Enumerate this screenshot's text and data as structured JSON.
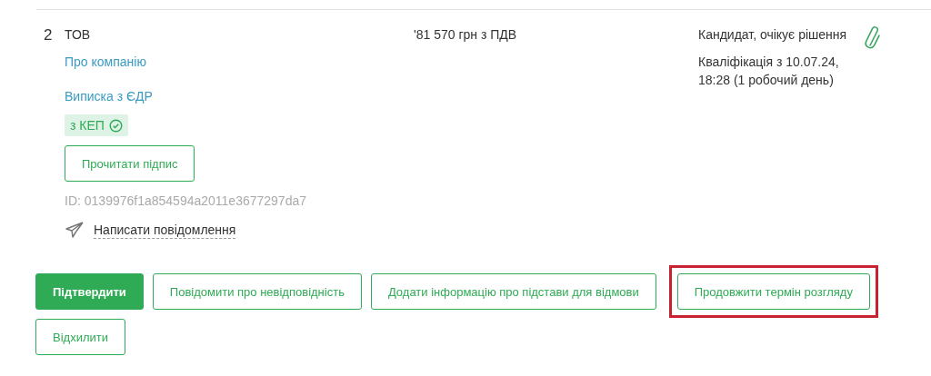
{
  "bid": {
    "number": "2",
    "name": "ТОВ",
    "links": [
      "Про компанію",
      "Виписка з ЄДР"
    ],
    "signature_badge": {
      "label": "з КЕП",
      "verified": true
    },
    "read_signature_button": "Прочитати підпис",
    "id_text": "ID: 0139976f1a854594a2011e3677297da7",
    "message_link": "Написати повідомлення",
    "amount": "'81 570 грн з ПДВ",
    "status": "Кандидат, очікує рішення",
    "qualification": "Кваліфікація з 10.07.24, 18:28 (1 робочий день)",
    "has_attachment": true
  },
  "actions": [
    {
      "label": "Підтвердити",
      "kind": "primary",
      "highlighted": false
    },
    {
      "label": "Повідомити про невідповідність",
      "kind": "outline",
      "highlighted": false
    },
    {
      "label": "Додати інформацію про підстави для відмови",
      "kind": "outline",
      "highlighted": false
    },
    {
      "label": "Продовжити термін розгляду",
      "kind": "outline",
      "highlighted": true
    },
    {
      "label": "Відхилити",
      "kind": "outline",
      "highlighted": false
    }
  ]
}
